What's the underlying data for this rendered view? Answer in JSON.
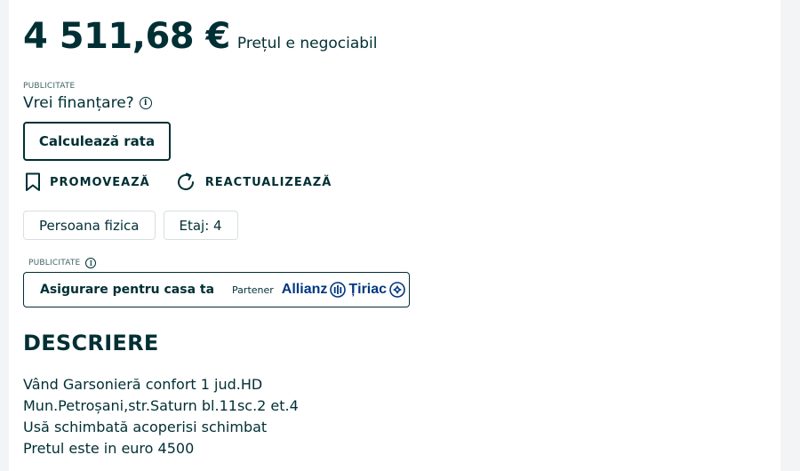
{
  "price": {
    "amount": "4 511,68 €",
    "note": "Prețul e negociabil"
  },
  "financing": {
    "ad_label": "PUBLICITATE",
    "question": "Vrei finanțare?",
    "info_icon": "info-icon",
    "calculate_button": "Calculează rata"
  },
  "actions": {
    "promote_label": "PROMOVEAZĂ",
    "promote_icon": "bookmark-icon",
    "refresh_label": "REACTUALIZEAZĂ",
    "refresh_icon": "refresh-icon"
  },
  "tags": [
    "Persoana fizica",
    "Etaj: 4"
  ],
  "insurance": {
    "ad_label": "PUBLICITATE",
    "title": "Asigurare pentru casa ta",
    "partner_label": "Partener",
    "brand_first": "Allianz",
    "brand_second": "Țiriac",
    "brand_color": "#003781"
  },
  "description": {
    "title": "DESCRIERE",
    "lines": [
      "Vând Garsonieră confort 1 jud.HD",
      "Mun.Petroșani,str.Saturn bl.11sc.2 et.4",
      "Usă schimbată acoperisi schimbat",
      "Pretul este in euro 4500"
    ]
  },
  "colors": {
    "text": "#002f34",
    "muted": "#406367",
    "border": "#d8dfe0",
    "background": "#f2f4f5"
  }
}
